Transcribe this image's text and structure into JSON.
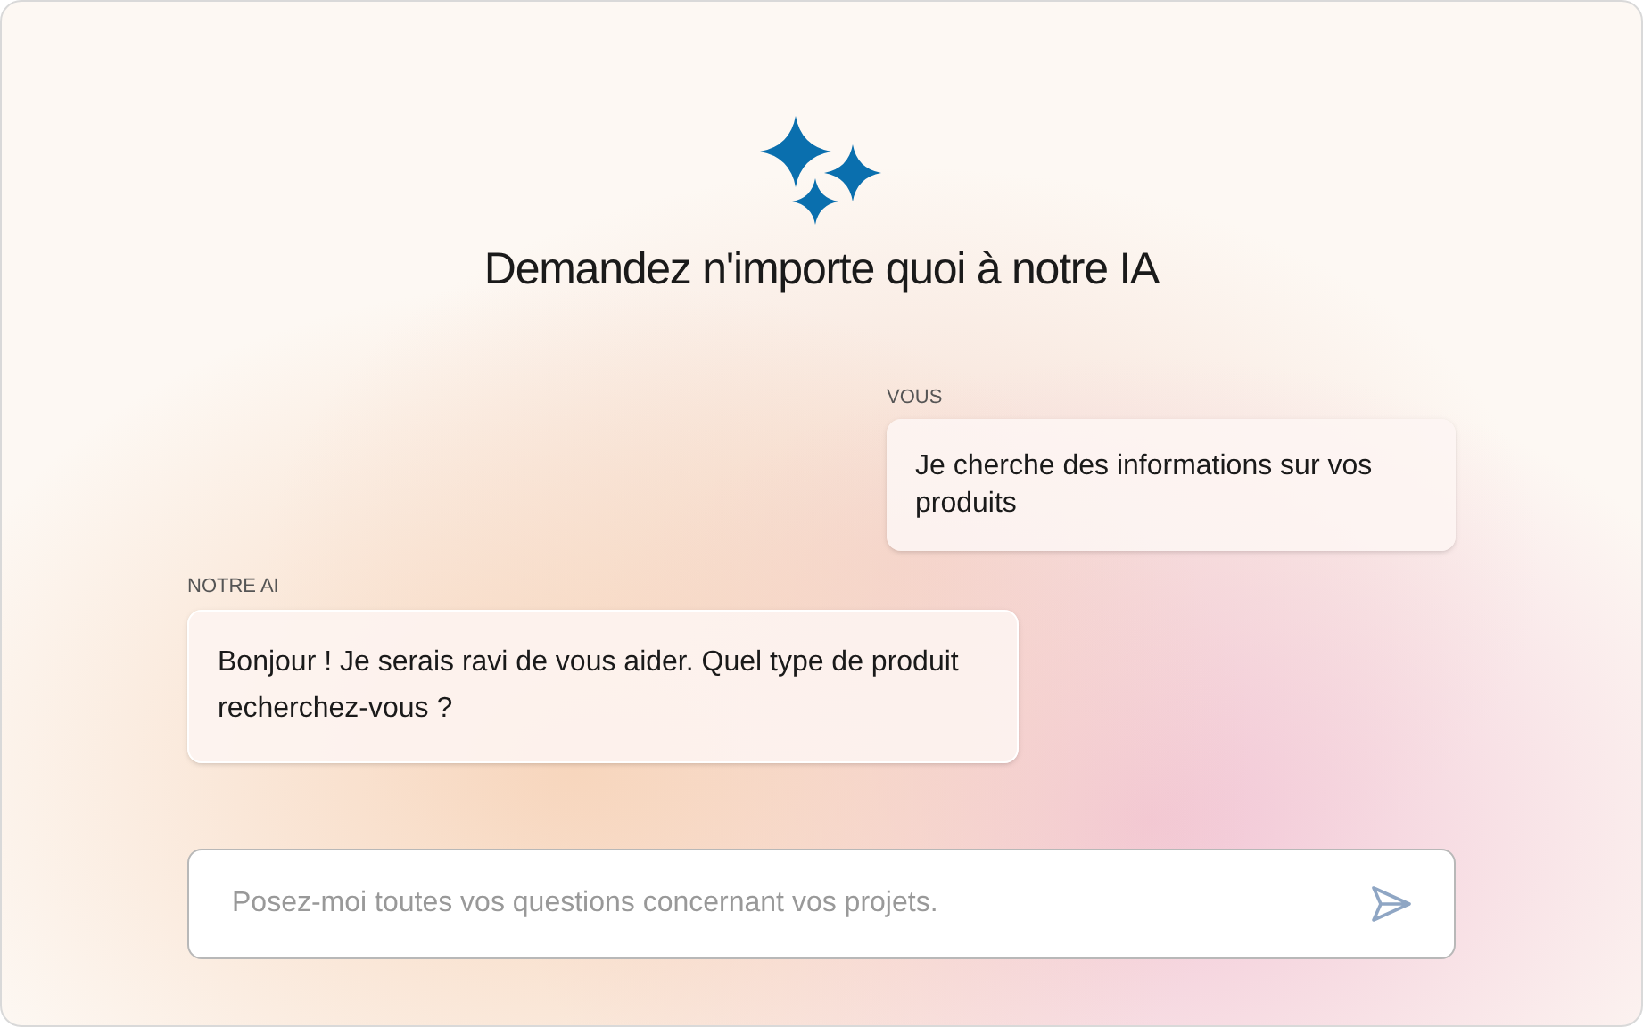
{
  "heading": "Demandez n'importe quoi à notre IA",
  "messages": [
    {
      "kind": "user",
      "sender": "VOUS",
      "text": "Je cherche des informations sur vos produits"
    },
    {
      "kind": "ai",
      "sender": "NOTRE AI",
      "text": "Bonjour ! Je serais ravi de vous aider. Quel type de produit recherchez-vous ?"
    }
  ],
  "composer": {
    "placeholder": "Posez-moi toutes vos questions concernant vos projets."
  }
}
